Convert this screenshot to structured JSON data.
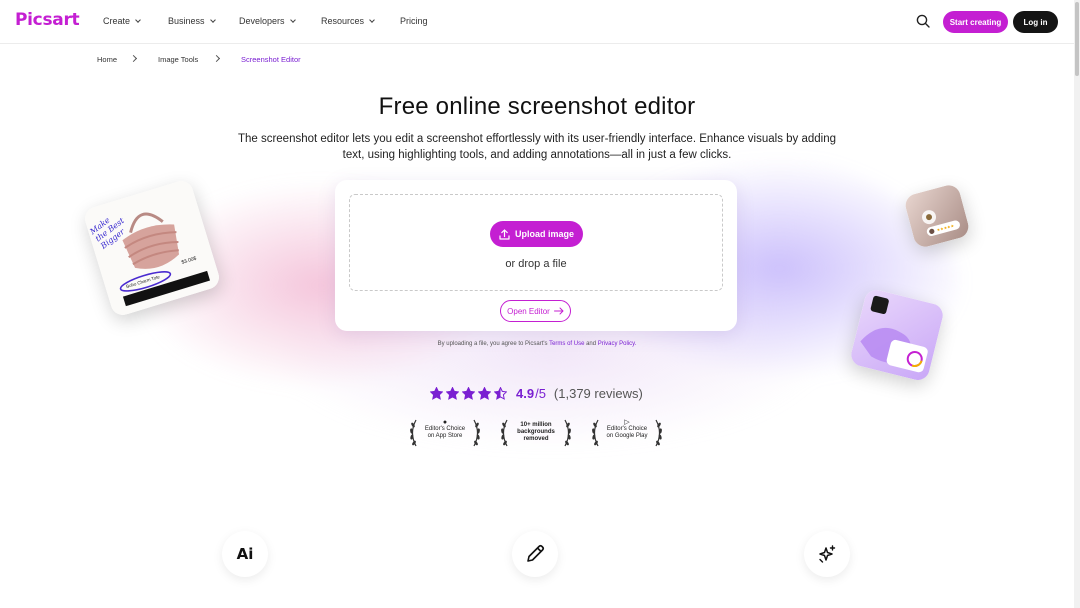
{
  "brand": {
    "name": "Picsart",
    "accent": "#c41fd2",
    "link": "#7a1fd2"
  },
  "nav": {
    "items": [
      {
        "label": "Create",
        "dropdown": true
      },
      {
        "label": "Business",
        "dropdown": true
      },
      {
        "label": "Developers",
        "dropdown": true
      },
      {
        "label": "Resources",
        "dropdown": true
      },
      {
        "label": "Pricing",
        "dropdown": false
      }
    ],
    "search_icon": "search-icon",
    "start_label": "Start creating",
    "login_label": "Log in"
  },
  "breadcrumb": [
    "Home",
    "Image Tools",
    "Screenshot Editor"
  ],
  "hero": {
    "title": "Free online screenshot editor",
    "subtitle_line1": "The screenshot editor lets you edit a screenshot effortlessly with its user-friendly interface. Enhance visuals by adding",
    "subtitle_line2": "text, using highlighting tools, and adding annotations—all in just a few clicks."
  },
  "upload": {
    "upload_label": "Upload image",
    "drop_text": "or drop a file",
    "editor_label": "Open Editor",
    "terms_prefix": "By uploading a file, you agree to Picsart's",
    "terms_link": "Terms of Use",
    "terms_and": "and",
    "privacy_link": "Privacy Policy."
  },
  "rating": {
    "stars_filled": 4.5,
    "stars_total": 5,
    "score": "4.9",
    "out_of": "/5",
    "reviews": "(1,379 reviews)"
  },
  "awards": [
    {
      "icon": "apple-icon",
      "line1": "Editor's Choice",
      "line2": "on App Store"
    },
    {
      "icon": "",
      "line1": "10+ million",
      "line2": "backgrounds",
      "line3": "removed"
    },
    {
      "icon": "google-play-icon",
      "line1": "Editor's Choice",
      "line2": "on Google Play"
    }
  ],
  "floating_card": {
    "handwriting": "Make the Best Bigger",
    "tag": "Boho Charm Tote",
    "price": "$3.00$"
  },
  "features": [
    {
      "icon": "ai-icon",
      "label": "Ai"
    },
    {
      "icon": "pencil-icon"
    },
    {
      "icon": "sparkles-icon"
    }
  ]
}
